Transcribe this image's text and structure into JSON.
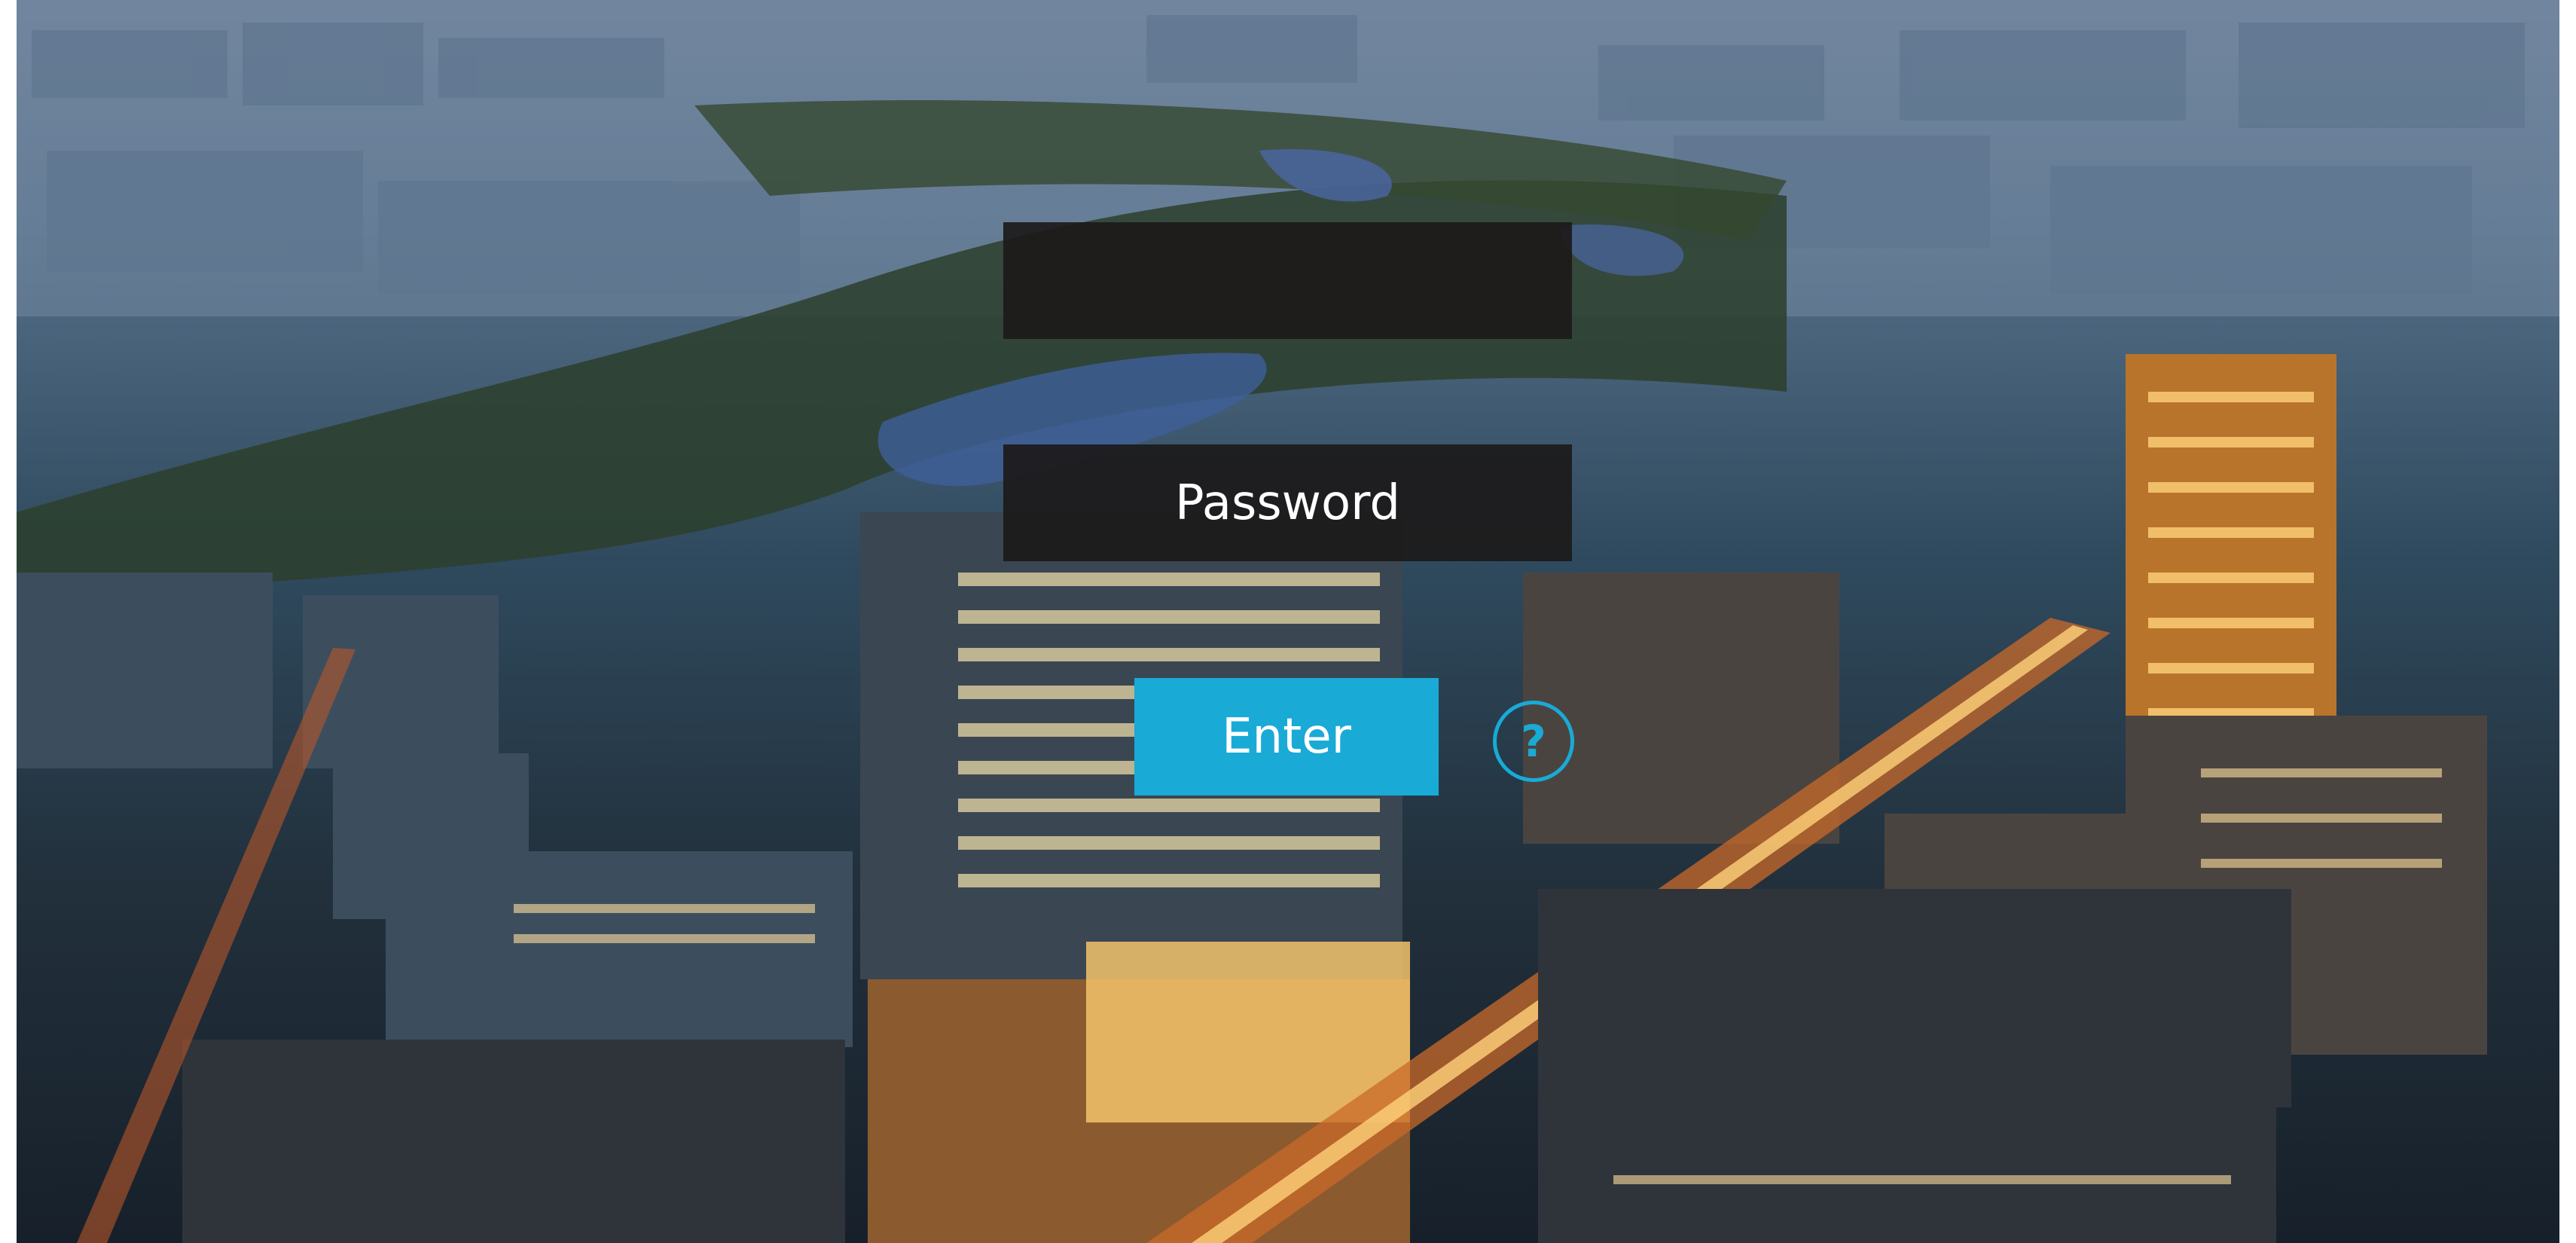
{
  "login": {
    "username_value": "",
    "username_placeholder": "",
    "password_value": "",
    "password_placeholder": "Password",
    "enter_label": "Enter",
    "help_label": "?"
  },
  "background": {
    "description_icon": "city-aerial-night-image"
  },
  "colors": {
    "accent": "#19aad6",
    "field_bg": "#1c1a1a",
    "text": "#ffffff"
  }
}
